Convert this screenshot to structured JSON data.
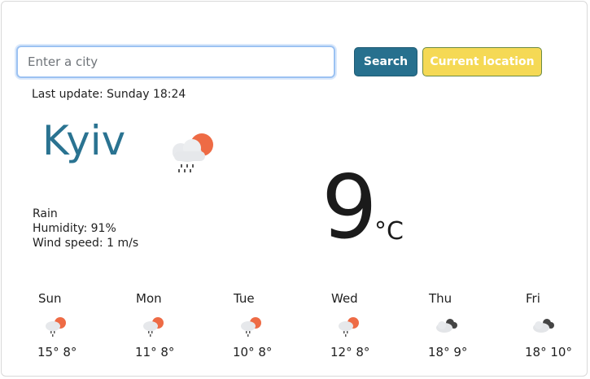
{
  "search": {
    "placeholder": "Enter a city",
    "search_label": "Search",
    "location_label": "Current location"
  },
  "current": {
    "last_update_label": "Last update:",
    "last_update_value": "Sunday 18:24",
    "city": "Kyiv",
    "icon": "rain-cloud-sun-icon",
    "description": "Rain",
    "humidity_label": "Humidity:",
    "humidity_value": "91%",
    "wind_label": "Wind speed:",
    "wind_value": "1 m/s",
    "temperature": "9",
    "unit": "°C"
  },
  "forecast": [
    {
      "day": "Sun",
      "icon": "rain-cloud-sun-icon",
      "max": "15°",
      "min": "8°"
    },
    {
      "day": "Mon",
      "icon": "rain-cloud-sun-icon",
      "max": "11°",
      "min": "8°"
    },
    {
      "day": "Tue",
      "icon": "rain-cloud-sun-icon",
      "max": "10°",
      "min": "8°"
    },
    {
      "day": "Wed",
      "icon": "rain-cloud-sun-icon",
      "max": "12°",
      "min": "8°"
    },
    {
      "day": "Thu",
      "icon": "broken-clouds-icon",
      "max": "18°",
      "min": "9°"
    },
    {
      "day": "Fri",
      "icon": "broken-clouds-icon",
      "max": "18°",
      "min": "10°"
    }
  ],
  "colors": {
    "accent": "#2a7391",
    "search_button": "#27708e",
    "location_button": "#f5d955",
    "sun": "#ee6b45"
  }
}
